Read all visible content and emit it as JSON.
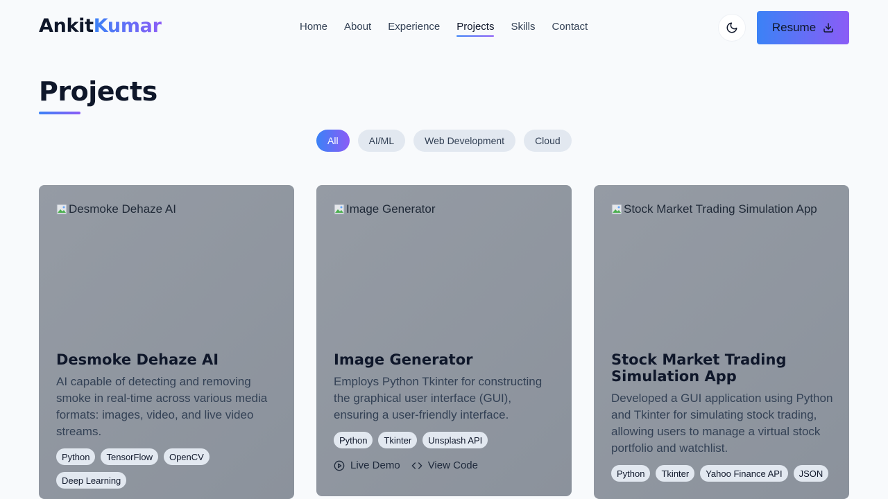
{
  "header": {
    "logo_first": "Ankit",
    "logo_second": "Kumar",
    "nav": [
      "Home",
      "About",
      "Experience",
      "Projects",
      "Skills",
      "Contact"
    ],
    "active_nav": "Projects",
    "resume_label": "Resume"
  },
  "section": {
    "title": "Projects"
  },
  "filters": {
    "items": [
      "All",
      "AI/ML",
      "Web Development",
      "Cloud"
    ],
    "active": "All"
  },
  "projects": [
    {
      "image_alt": "Desmoke Dehaze AI",
      "title": "Desmoke Dehaze AI",
      "description": "AI capable of detecting and removing smoke in real-time across various media formats: images, video, and live video streams.",
      "tags": [
        "Python",
        "TensorFlow",
        "OpenCV",
        "Deep Learning"
      ]
    },
    {
      "image_alt": "Image Generator",
      "title": "Image Generator",
      "description": "Employs Python Tkinter for constructing the graphical user interface (GUI), ensuring a user-friendly interface.",
      "tags": [
        "Python",
        "Tkinter",
        "Unsplash API"
      ],
      "live_demo_label": "Live Demo",
      "view_code_label": "View Code"
    },
    {
      "image_alt": "Stock Market Trading Simulation App",
      "title": "Stock Market Trading Simulation App",
      "description": "Developed a GUI application using Python and Tkinter for simulating stock trading, allowing users to manage a virtual stock portfolio and watchlist.",
      "tags": [
        "Python",
        "Tkinter",
        "Yahoo Finance API",
        "JSON"
      ]
    }
  ],
  "colors": {
    "accent_start": "#3b82f6",
    "accent_end": "#8b5cf6",
    "background": "#f8fafc"
  },
  "icons": {
    "theme_toggle": "moon-icon",
    "resume": "download-icon",
    "live_demo": "play-circle-icon",
    "view_code": "code-icon"
  }
}
